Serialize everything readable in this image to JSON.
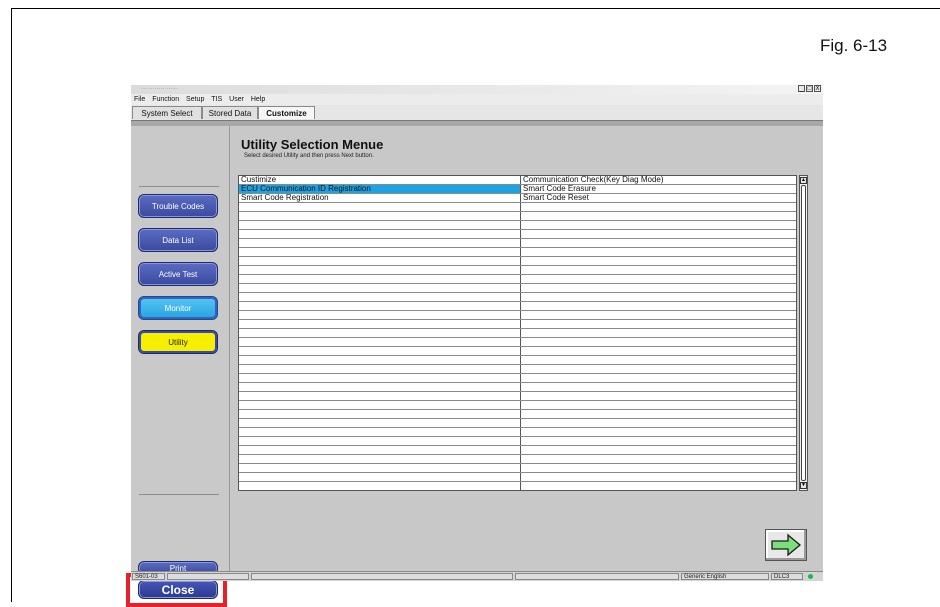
{
  "figure_label": "Fig. 6-13",
  "window": {
    "title": "... ........ ......",
    "controls": [
      "_",
      "□",
      "X"
    ]
  },
  "menu": [
    "File",
    "Function",
    "Setup",
    "TIS",
    "User",
    "Help"
  ],
  "tabs": [
    {
      "label": "System Select",
      "active": false
    },
    {
      "label": "Stored Data",
      "active": false
    },
    {
      "label": "Customize",
      "active": true
    }
  ],
  "sidebar": {
    "buttons": [
      {
        "name": "trouble-codes-button",
        "label": "Trouble Codes"
      },
      {
        "name": "data-list-button",
        "label": "Data List"
      },
      {
        "name": "active-test-button",
        "label": "Active Test"
      },
      {
        "name": "monitor-button",
        "label": "Monitor"
      },
      {
        "name": "utility-button",
        "label": "Utility"
      }
    ],
    "print_label": "Print",
    "close_label": "Close"
  },
  "main": {
    "heading": "Utility Selection Menue",
    "subheading": "Select desired Utility and then press Next button.",
    "rows": [
      [
        "Custimize",
        "Communication Check(Key Diag Mode)"
      ],
      [
        "ECU Communication ID Registration",
        "Smart Code Erasure"
      ],
      [
        "Smart Code Registration",
        "Smart Code Reset"
      ],
      [
        "",
        ""
      ],
      [
        "",
        ""
      ],
      [
        "",
        ""
      ],
      [
        "",
        ""
      ],
      [
        "",
        ""
      ],
      [
        "",
        ""
      ],
      [
        "",
        ""
      ],
      [
        "",
        ""
      ],
      [
        "",
        ""
      ],
      [
        "",
        ""
      ],
      [
        "",
        ""
      ],
      [
        "",
        ""
      ],
      [
        "",
        ""
      ],
      [
        "",
        ""
      ],
      [
        "",
        ""
      ],
      [
        "",
        ""
      ],
      [
        "",
        ""
      ],
      [
        "",
        ""
      ],
      [
        "",
        ""
      ],
      [
        "",
        ""
      ],
      [
        "",
        ""
      ],
      [
        "",
        ""
      ],
      [
        "",
        ""
      ],
      [
        "",
        ""
      ],
      [
        "",
        ""
      ],
      [
        "",
        ""
      ],
      [
        "",
        ""
      ],
      [
        "",
        ""
      ],
      [
        "",
        ""
      ],
      [
        "",
        ""
      ],
      [
        "",
        ""
      ],
      [
        "",
        ""
      ]
    ],
    "selected_row": 1,
    "selected_col": 0
  },
  "status": {
    "left": "S601-03",
    "language": "Generic English",
    "connector": "DLC3"
  },
  "colors": {
    "highlight": "#e8202a",
    "selection": "#1ba3e6",
    "utility": "#f6f000",
    "button_blue": "#3a4a9e"
  }
}
